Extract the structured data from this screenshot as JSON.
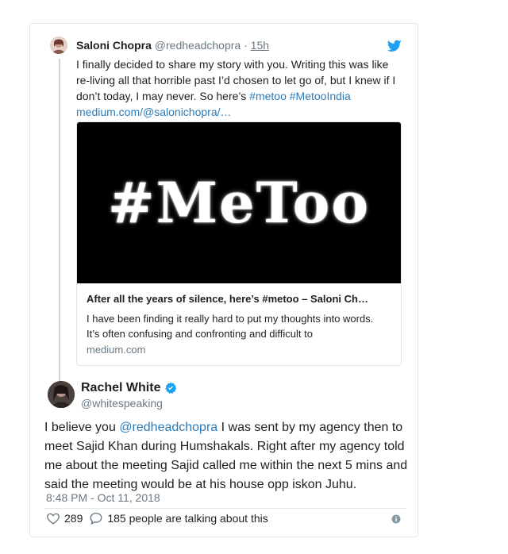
{
  "quoted_tweet": {
    "author_name": "Saloni Chopra",
    "author_handle": "@redheadchopra",
    "separator": "·",
    "time": "15h",
    "text_before": "I finally decided to share my story with you. Writing this was like re-living all that horrible past I’d chosen to let go of, but I knew if I don’t today, I may never. So here’s",
    "hashtag_1": "#metoo",
    "hashtag_2": "#MetooIndia",
    "link_text": "medium.com/@salonichopra/…",
    "card": {
      "image_text": "#MeToo",
      "title": "After all the years of silence, here’s #metoo – Saloni Ch…",
      "description": "I have been finding it really hard to put my thoughts into words. It’s often confusing and confronting and difficult to",
      "domain": "medium.com"
    }
  },
  "reply_tweet": {
    "author_name": "Rachel White",
    "author_handle": "@whitespeaking",
    "mention": "@redheadchopra",
    "text_before": "I believe you",
    "text_after": "I was sent by my agency then to meet Sajid Khan during Humshakals. Right after my agency told me about the meeting Sajid called me within the next 5 mins and said the meeting would be at his house opp iskon Juhu.",
    "timestamp": "8:48 PM - Oct 11, 2018",
    "like_count": "289",
    "talking_text": "185 people are talking about this"
  },
  "icons": {
    "bird": "twitter-bird-icon",
    "verified": "verified-badge-icon",
    "heart": "heart-icon",
    "reply": "speech-bubble-icon",
    "info": "info-icon"
  },
  "colors": {
    "link_blue": "#2b7bb9",
    "verified_blue": "#1da1f2",
    "muted_gray": "#697882"
  }
}
